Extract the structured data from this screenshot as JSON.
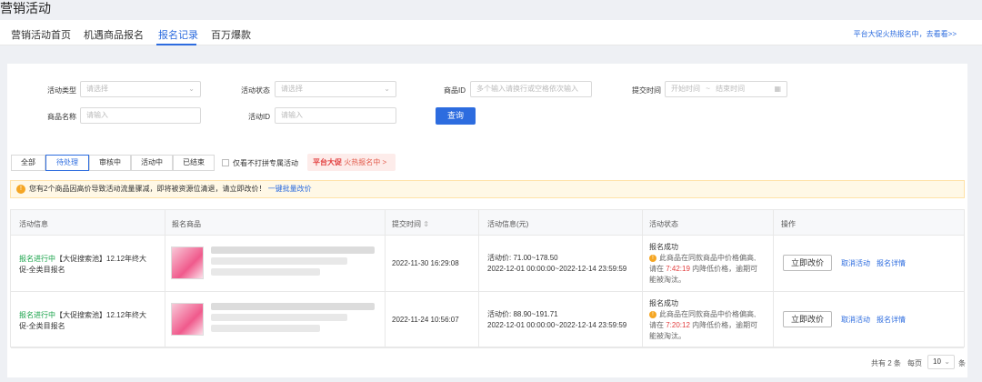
{
  "page_title": "营销活动",
  "nav": {
    "tabs": [
      "营销活动首页",
      "机遇商品报名",
      "报名记录",
      "百万爆款"
    ],
    "active_index": 2,
    "promo_link": "平台大促火热报名中，去看看>>"
  },
  "filters": {
    "activity_type_label": "活动类型",
    "activity_type_placeholder": "请选择",
    "activity_status_label": "活动状态",
    "activity_status_placeholder": "请选择",
    "product_id_label": "商品ID",
    "product_id_placeholder": "多个输入请换行或空格依次输入",
    "submit_time_label": "提交时间",
    "start_time_placeholder": "开始时间",
    "range_separator": "~",
    "end_time_placeholder": "结束时间",
    "product_name_label": "商品名称",
    "product_name_placeholder": "请输入",
    "activity_id_label": "活动ID",
    "activity_id_placeholder": "请输入",
    "query_button": "查询"
  },
  "status_tabs": [
    "全部",
    "待处理",
    "审核中",
    "活动中",
    "已结束"
  ],
  "status_active_index": 1,
  "only_unbound_label": "仅看不打拼专属活动",
  "hot_badge": {
    "title": "平台大促",
    "text": "火热报名中",
    "arrow": ">"
  },
  "warning": {
    "text": "您有2个商品因高价导致活动流量骤减，即将被资源位清退，请立即改价！",
    "link": "一键批量改价"
  },
  "table": {
    "headers": [
      "活动信息",
      "报名商品",
      "提交时间",
      "活动信息(元)",
      "活动状态",
      "操作"
    ],
    "sort_icon": "⇕",
    "rows": [
      {
        "status_tag": "报名进行中",
        "activity_line1": "【大促搜索池】12.12年终大",
        "activity_line2": "促-全类目报名",
        "submit_time": "2022-11-30 16:29:08",
        "price_line": "活动价: 71.00~178.50",
        "period": "2022-12-01 00:00:00~2022-12-14 23:59:59",
        "state": "报名成功",
        "note1": "此商品在同款商品中价格偏高,",
        "note2_prefix": "请在",
        "countdown": "7:42:19",
        "note2_suffix": "内降低价格，逾期可",
        "note3": "能被淘汰。",
        "btn_price": "立即改价",
        "link_cancel": "取消活动",
        "link_detail": "报名详情"
      },
      {
        "status_tag": "报名进行中",
        "activity_line1": "【大促搜索池】12.12年终大",
        "activity_line2": "促-全类目报名",
        "submit_time": "2022-11-24 10:56:07",
        "price_line": "活动价: 88.90~191.71",
        "period": "2022-12-01 00:00:00~2022-12-14 23:59:59",
        "state": "报名成功",
        "note1": "此商品在同款商品中价格偏高,",
        "note2_prefix": "请在",
        "countdown": "7:20:12",
        "note2_suffix": "内降低价格，逾期可",
        "note3": "能被淘汰。",
        "btn_price": "立即改价",
        "link_cancel": "取消活动",
        "link_detail": "报名详情"
      }
    ]
  },
  "pager": {
    "total_text": "共有 2 条",
    "per_page_label": "每页",
    "per_page_value": "10",
    "unit": "条"
  },
  "colors": {
    "accent": "#2d6cdf",
    "success": "#19a34a",
    "danger": "#e23c3c",
    "warning": "#f5a623"
  }
}
